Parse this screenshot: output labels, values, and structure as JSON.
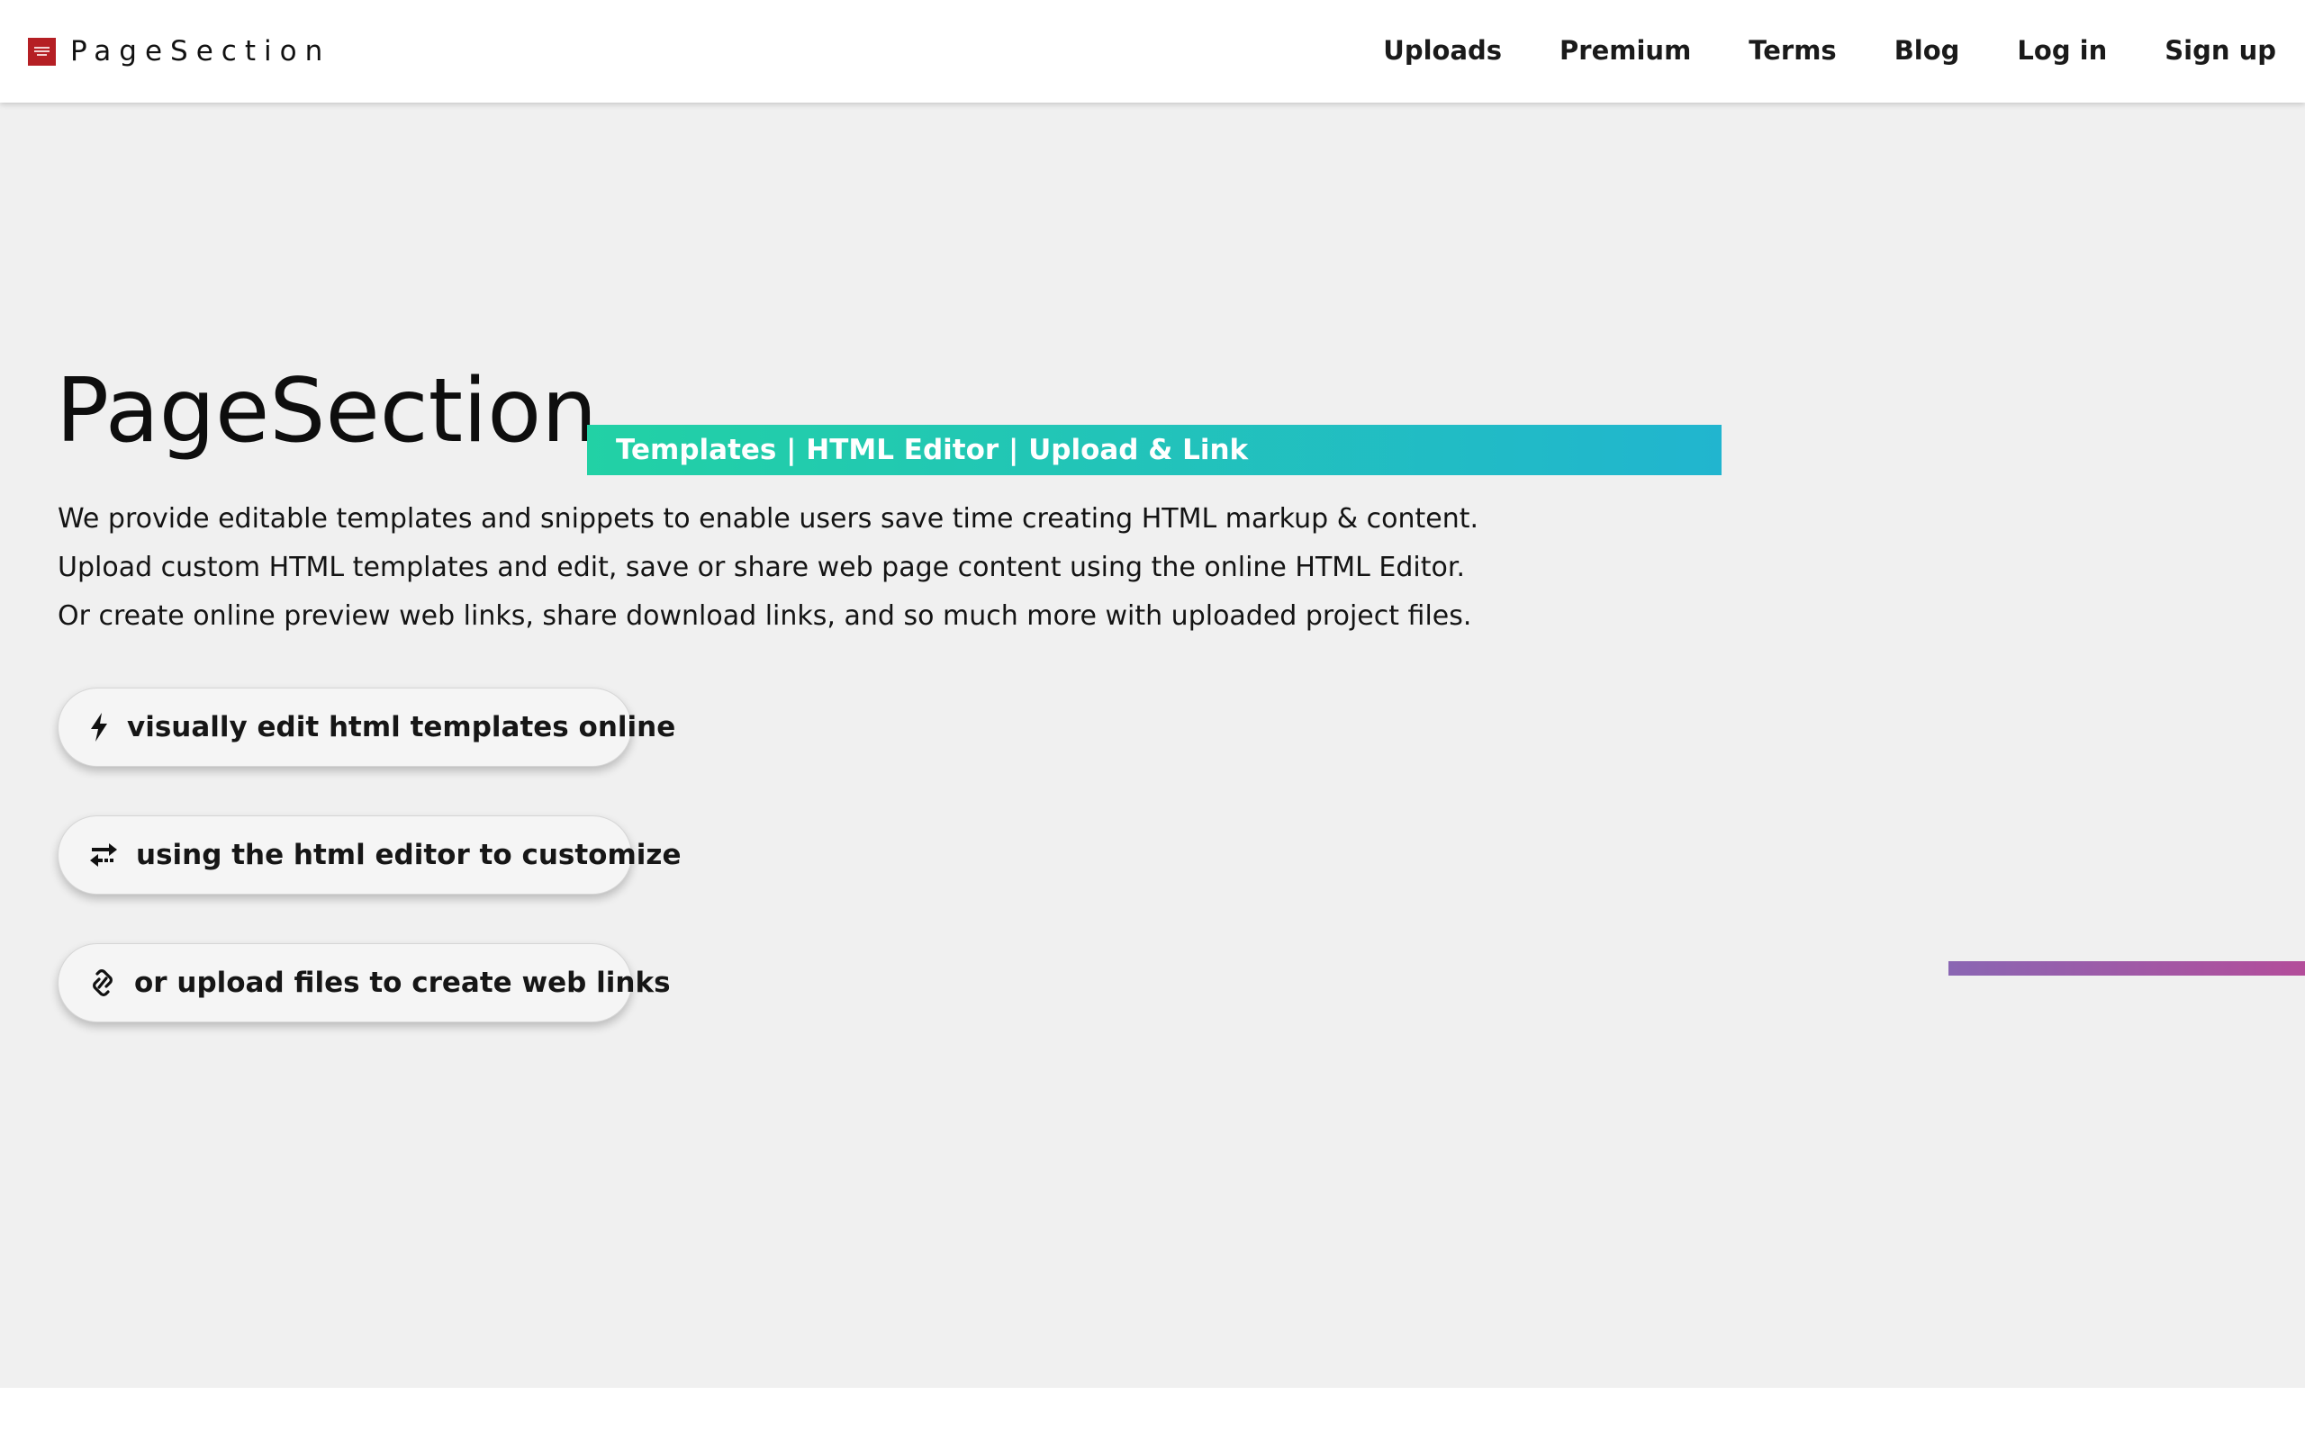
{
  "brand": {
    "name": "PageSection",
    "logo_color": "#b51f24"
  },
  "nav": {
    "items": [
      {
        "label": "Uploads"
      },
      {
        "label": "Premium"
      },
      {
        "label": "Terms"
      },
      {
        "label": "Blog"
      },
      {
        "label": "Log in"
      },
      {
        "label": "Sign up"
      }
    ]
  },
  "hero": {
    "title": "PageSection",
    "tagline": "Templates | HTML Editor | Upload & Link",
    "tagline_gradient": [
      "#22d1a5",
      "#21b5cf"
    ],
    "description": [
      "We provide editable templates and snippets to enable users save time creating HTML markup & content.",
      "Upload custom HTML templates and edit, save or share web page content using the online HTML Editor.",
      "Or create online preview web links, share download links, and so much more with uploaded project files."
    ],
    "buttons": [
      {
        "icon": "bolt-icon",
        "label": "visually edit html templates online"
      },
      {
        "icon": "swap-arrows-icon",
        "label": "using the html editor to customize"
      },
      {
        "icon": "link-icon",
        "label": "or upload files to create web links"
      }
    ],
    "accent_gradient": [
      "#8a66b3",
      "#b34d9a"
    ],
    "background": "#f0f0f0"
  }
}
